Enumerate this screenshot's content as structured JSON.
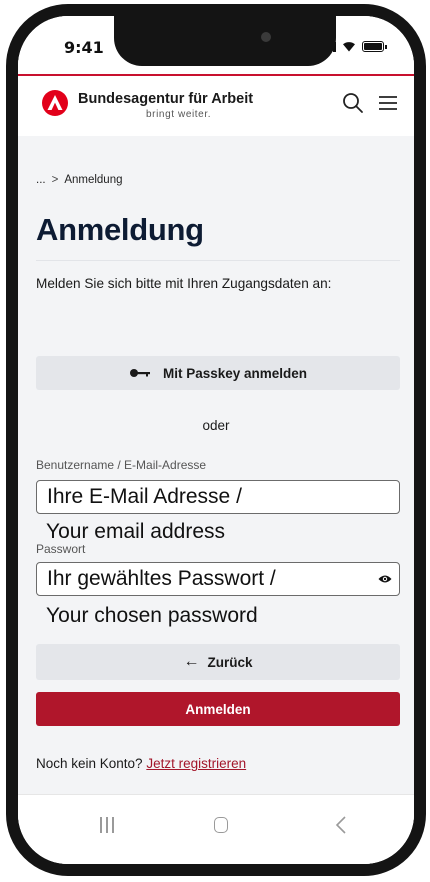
{
  "status_bar": {
    "time": "9:41",
    "icons": [
      "signal-icon",
      "wifi-icon",
      "battery-icon"
    ]
  },
  "header": {
    "brand": "Bundesagentur für Arbeit",
    "tagline": "bringt weiter.",
    "icons": [
      "ba-logo-icon",
      "search-icon",
      "menu-icon"
    ]
  },
  "breadcrumb": {
    "ellipsis": "...",
    "separator": ">",
    "current": "Anmeldung"
  },
  "page": {
    "title": "Anmeldung",
    "intro": "Melden Sie sich bitte mit Ihren Zugangsdaten an:"
  },
  "passkey": {
    "label": "Mit Passkey anmelden",
    "icon": "key-icon"
  },
  "divider_text": "oder",
  "username": {
    "label": "Benutzername / E-Mail-Adresse",
    "placeholder": "Ihre E-Mail Adresse /",
    "note": "Your email address"
  },
  "password": {
    "label": "Passwort",
    "placeholder": "Ihr gewähltes Passwort /",
    "note": "Your chosen password",
    "icon": "eye-icon"
  },
  "back_button": {
    "arrow": "←",
    "label": "Zurück"
  },
  "login_button": {
    "label": "Anmelden"
  },
  "register": {
    "prompt": "Noch kein Konto?",
    "link": "Jetzt registrieren"
  },
  "nav_bar": {
    "icons": [
      "recent-apps-icon",
      "home-icon",
      "back-icon"
    ]
  },
  "colors": {
    "brand_red": "#c8102e",
    "button_red": "#b0162b",
    "title_navy": "#0d1b33",
    "content_bg": "#f3f4f6",
    "secondary_button": "#e4e6ea"
  }
}
